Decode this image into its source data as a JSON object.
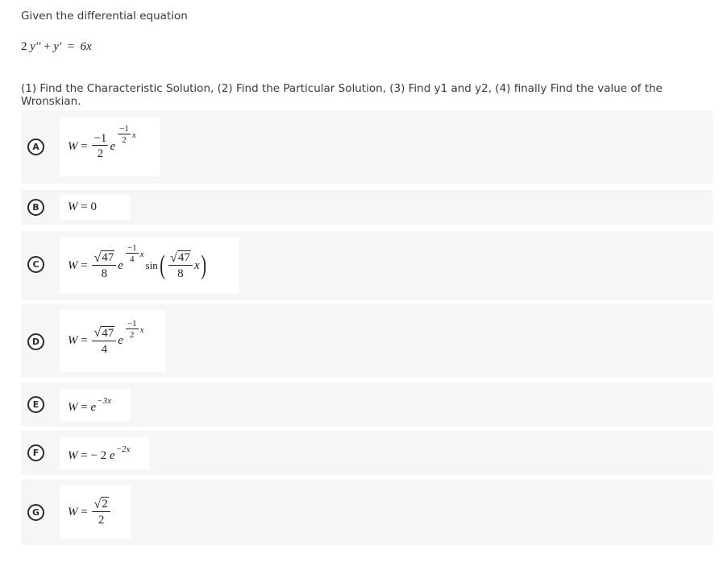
{
  "question": {
    "intro": "Given the differential equation",
    "equation": {
      "lhs_coef": "2",
      "y2": "y''",
      "plus": "+",
      "y1": "y'",
      "eq": "=",
      "rhs": "6x"
    },
    "instructions": "(1) Find the Characteristic Solution, (2) Find the Particular Solution, (3) Find y1 and y2, (4) finally Find the value of the Wronskian."
  },
  "options": [
    {
      "letter": "A",
      "W": "W",
      "eq": "=",
      "coef_num": "−1",
      "coef_den": "2",
      "base": "e",
      "exp_num": "−1",
      "exp_den": "2",
      "exp_var": "x"
    },
    {
      "letter": "B",
      "W": "W",
      "eq": "=",
      "value": "0"
    },
    {
      "letter": "C",
      "W": "W",
      "eq": "=",
      "coef_rad": "47",
      "coef_den": "8",
      "base": "e",
      "exp_num": "−1",
      "exp_den": "4",
      "exp_var": "x",
      "func": "sin",
      "arg_rad": "47",
      "arg_den": "8",
      "arg_var": "x"
    },
    {
      "letter": "D",
      "W": "W",
      "eq": "=",
      "coef_rad": "47",
      "coef_den": "4",
      "base": "e",
      "exp_num": "−1",
      "exp_den": "2",
      "exp_var": "x"
    },
    {
      "letter": "E",
      "W": "W",
      "eq": "=",
      "base": "e",
      "exp": "−3x"
    },
    {
      "letter": "F",
      "W": "W",
      "eq": "=",
      "coef": "− 2",
      "base": "e",
      "exp": "−2x"
    },
    {
      "letter": "G",
      "W": "W",
      "eq": "=",
      "coef_rad": "2",
      "coef_den": "2"
    }
  ],
  "colors": {
    "row_bg": "#f6f6f6",
    "card_bg": "#ffffff",
    "badge": "#2b2b2b"
  }
}
